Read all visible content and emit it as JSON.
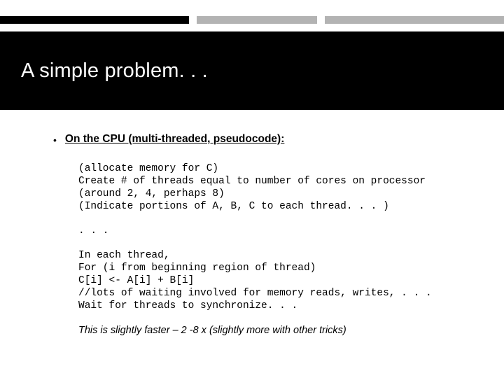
{
  "title": "A simple problem. . .",
  "bullet": {
    "marker": "•",
    "text": "On the CPU (multi-threaded, pseudocode):"
  },
  "code_block_1": "(allocate memory for C)\nCreate # of threads equal to number of cores on processor\n(around 2, 4, perhaps 8)\n(Indicate portions of A, B, C to each thread. . . )",
  "ellipsis": ". . .",
  "code_block_2": "In each thread,\nFor (i from beginning region of thread)\nC[i] <- A[i] + B[i]\n//lots of waiting involved for memory reads, writes, . . .\nWait for threads to synchronize. . .",
  "footnote": "This is slightly faster – 2 -8 x (slightly more with other tricks)"
}
